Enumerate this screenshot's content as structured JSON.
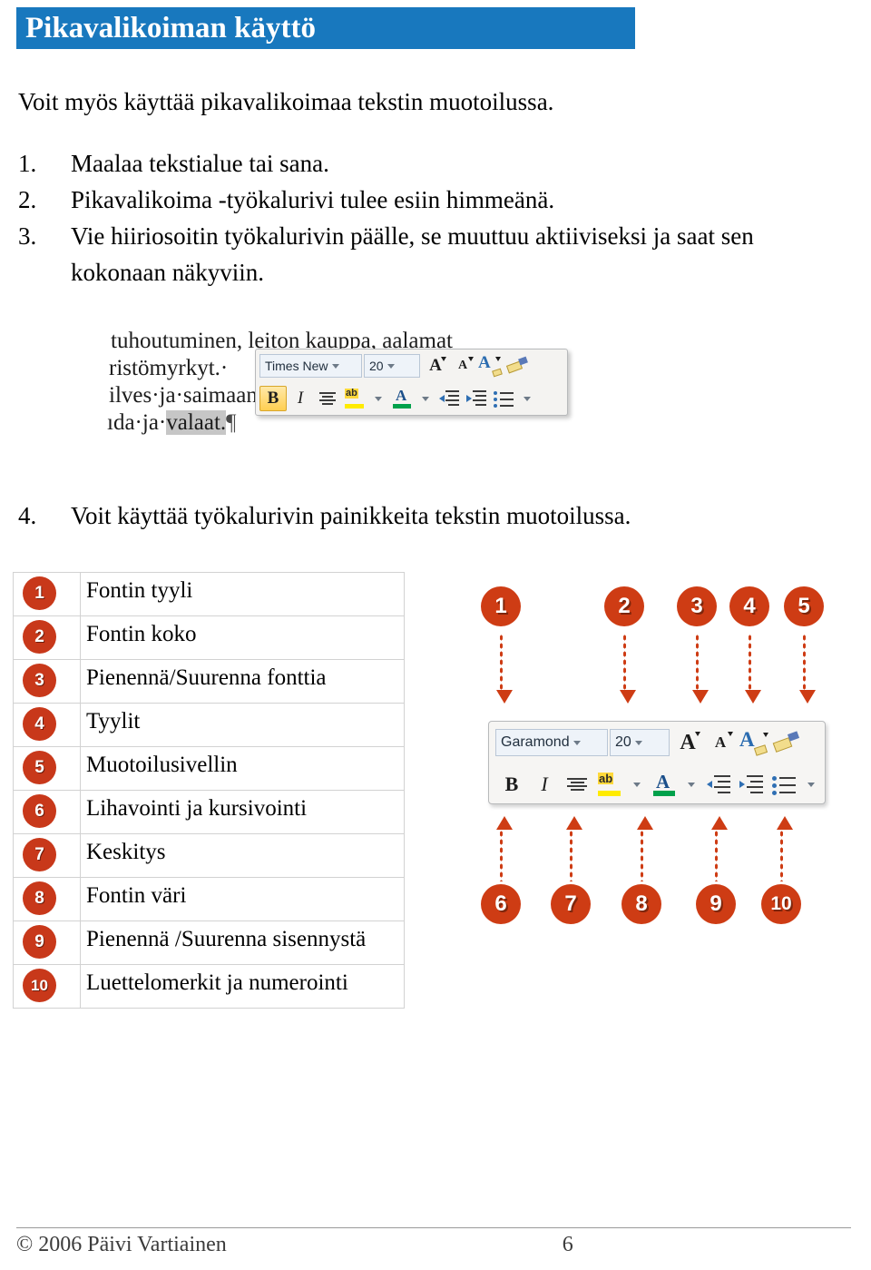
{
  "document": {
    "title": "Pikavalikoiman käyttö",
    "intro": "Voit myös käyttää pikavalikoimaa tekstin muotoilussa.",
    "steps": [
      {
        "num": "1.",
        "text": "Maalaa tekstialue tai sana."
      },
      {
        "num": "2.",
        "text": "Pikavalikoima -työkalurivi tulee esiin himmeänä."
      },
      {
        "num": "3.",
        "text": "Vie hiiriosoitin työkalurivin päälle, se muuttuu aktiiviseksi ja saat sen kokonaan näkyviin."
      }
    ],
    "step4": {
      "num": "4.",
      "text": "Voit käyttää työkalurivin painikkeita tekstin muotoilussa."
    }
  },
  "screenshot_faded": {
    "caption_lines": [
      "tuhoutuminen, leiton kauppa, aalamat",
      "ristömyrkyt.·",
      "ilves·ja·saimaannorppa, sudet ja ilves",
      "nda·ja·",
      "valaat."
    ],
    "minitoolbar": {
      "font_name": "Times New",
      "font_size": "20",
      "tools_row1": [
        "grow-font",
        "shrink-font",
        "text-styles",
        "format-painter"
      ],
      "tools_row2": [
        "bold",
        "italic",
        "center",
        "highlight",
        "font-color",
        "decrease-indent",
        "increase-indent",
        "bullets"
      ]
    }
  },
  "screenshot_annotated": {
    "minitoolbar": {
      "font_name": "Garamond",
      "font_size": "20"
    },
    "callouts_top": [
      "1",
      "2",
      "3",
      "4",
      "5"
    ],
    "callouts_bottom": [
      "6",
      "7",
      "8",
      "9",
      "10"
    ]
  },
  "legend": {
    "rows": [
      {
        "num": "1",
        "label": "Fontin tyyli"
      },
      {
        "num": "2",
        "label": "Fontin koko"
      },
      {
        "num": "3",
        "label": "Pienennä/Suurenna fonttia"
      },
      {
        "num": "4",
        "label": "Tyylit"
      },
      {
        "num": "5",
        "label": "Muotoilusivellin"
      },
      {
        "num": "6",
        "label": "Lihavointi ja kursivointi"
      },
      {
        "num": "7",
        "label": "Keskitys"
      },
      {
        "num": "8",
        "label": "Fontin väri"
      },
      {
        "num": "9",
        "label": "Pienennä /Suurenna sisennystä"
      },
      {
        "num": "10",
        "label": "Luettelomerkit ja numerointi"
      }
    ]
  },
  "footer": {
    "copyright": "© 2006 Päivi Vartiainen",
    "page_number": "6"
  },
  "colors": {
    "banner_blue": "#1878be",
    "callout_red": "#ce3c14",
    "badge_red": "#c8381a",
    "highlight_yellow": "#ffeb00",
    "font_color_green": "#00a14b"
  }
}
